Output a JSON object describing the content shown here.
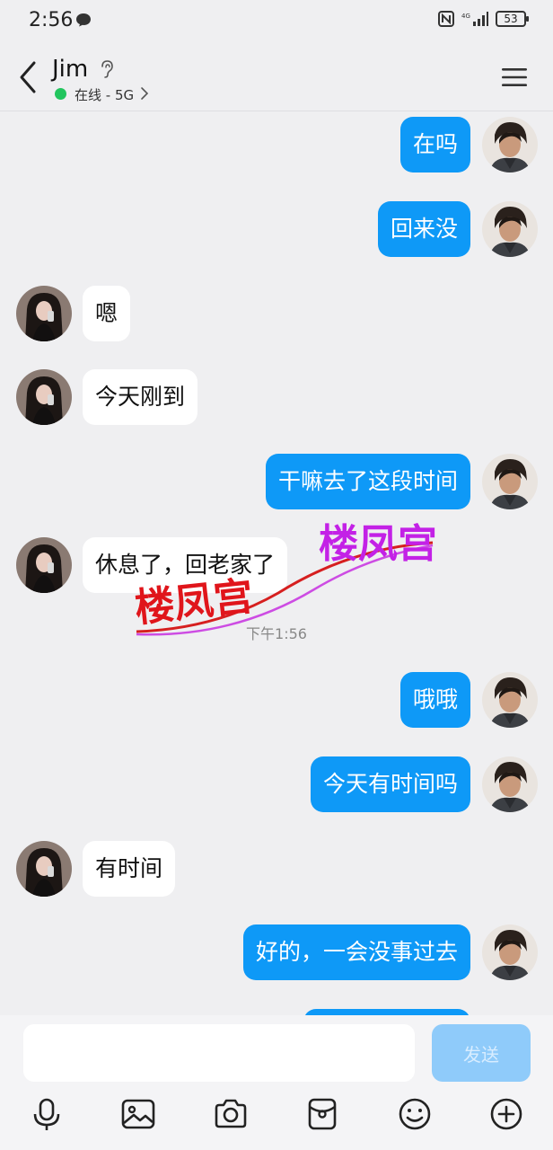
{
  "status_bar": {
    "time": "2:56",
    "battery": "53",
    "network": "4G"
  },
  "header": {
    "contact_name": "Jim",
    "status_text": "在线 - 5G"
  },
  "messages": [
    {
      "sender": "me",
      "text": "在吗"
    },
    {
      "sender": "me",
      "text": "回来没"
    },
    {
      "sender": "her",
      "text": "嗯"
    },
    {
      "sender": "her",
      "text": "今天刚到"
    },
    {
      "sender": "me",
      "text": "干嘛去了这段时间"
    },
    {
      "sender": "her",
      "text": "休息了，回老家了"
    },
    {
      "sender": "me",
      "text": "哦哦"
    },
    {
      "sender": "me",
      "text": "今天有时间吗"
    },
    {
      "sender": "her",
      "text": "有时间"
    },
    {
      "sender": "me",
      "text": "好的，一会没事过去"
    }
  ],
  "timestamp": "下午1:56",
  "watermark": {
    "text_left": "楼凤宫",
    "text_right": "楼凤宫"
  },
  "input": {
    "send_label": "发送",
    "placeholder": ""
  },
  "toolbar": [
    "microphone-icon",
    "image-icon",
    "camera-icon",
    "red-packet-icon",
    "emoji-icon",
    "plus-icon"
  ],
  "colors": {
    "my_bubble": "#0e99f7",
    "her_bubble": "#ffffff",
    "background": "#efeff1",
    "online": "#22c55e",
    "send_button": "#8fcbfa"
  }
}
